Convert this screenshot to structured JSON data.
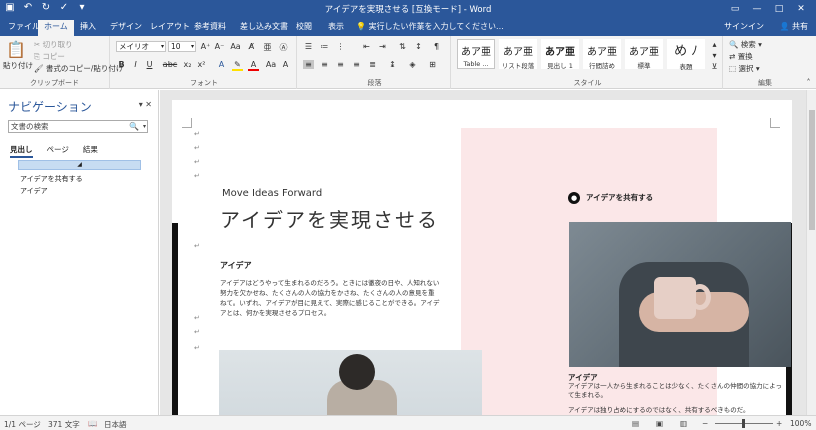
{
  "window": {
    "title": "アイデアを実現させる [互換モード] - Word",
    "controls": [
      "—",
      "□",
      "✕"
    ]
  },
  "qat": {
    "save": "save-icon",
    "undo": "undo-icon",
    "redo": "redo-icon",
    "check": "check-icon",
    "customize": "dropdown-icon"
  },
  "tabs": [
    "ファイル",
    "ホーム",
    "挿入",
    "デザイン",
    "レイアウト",
    "参考資料",
    "差し込み文書",
    "校閲",
    "表示"
  ],
  "active_tab": "ホーム",
  "tell_me": "実行したい作業を入力してください...",
  "signin": "サインイン",
  "share": "共有",
  "ribbon": {
    "clipboard": {
      "label": "クリップボード",
      "paste": "貼り付け",
      "cut": "切り取り",
      "copy": "コピー",
      "format_painter": "書式のコピー/貼り付け"
    },
    "font": {
      "label": "フォント",
      "family": "メイリオ",
      "size": "10",
      "buttons": [
        "B",
        "I",
        "U",
        "abc",
        "x₂",
        "x²",
        "A",
        "A",
        "Aa",
        "A"
      ]
    },
    "paragraph": {
      "label": "段落"
    },
    "styles": {
      "label": "スタイル",
      "items": [
        {
          "sample": "あア亜",
          "name": "Table ..."
        },
        {
          "sample": "あア亜",
          "name": "リスト段落"
        },
        {
          "sample": "あア亜",
          "name": "見出し 1"
        },
        {
          "sample": "あア亜",
          "name": "行間詰め"
        },
        {
          "sample": "あア亜",
          "name": "標準"
        },
        {
          "sample": "め ﾉ",
          "name": "表題"
        }
      ]
    },
    "editing": {
      "label": "編集",
      "find": "検索",
      "replace": "置換",
      "select": "選択"
    }
  },
  "navigation": {
    "title": "ナビゲーション",
    "search_placeholder": "文書の検索",
    "tabs": [
      "見出し",
      "ページ",
      "結果"
    ],
    "active_tab": "見出し",
    "headings": [
      "アイデアを共有する",
      "アイデア"
    ]
  },
  "document": {
    "subtitle": "Move Ideas Forward",
    "title": "アイデアを実現させる",
    "section_heading": "アイデア",
    "paragraph": "アイデアはどうやって生まれるのだろう。ときには徹夜の日や、人知れない努力を欠かせね、たくさんの人の協力をかさね、たくさんの人の意見を重ねて。いずれ、アイデアが目に見えて、実際に感じることができる。アイデアとは、何かを実現させるプロセス。",
    "share_heading": "アイデアを共有する",
    "caption_heading": "アイデア",
    "caption_1": "アイデアは一人から生まれることは少なく、たくさんの仲間の協力によって生まれる。",
    "caption_2": "アイデアは独り占めにするのではなく、共有するべきものだ。"
  },
  "status": {
    "page": "1/1 ページ",
    "words": "371 文字",
    "language": "日本語",
    "zoom": "100%"
  }
}
